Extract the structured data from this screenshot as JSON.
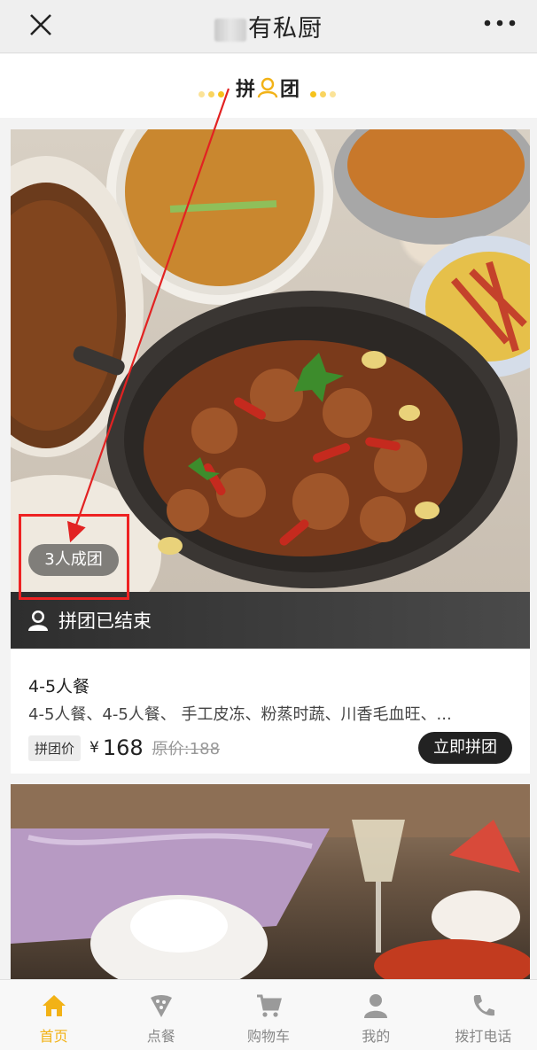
{
  "topbar": {
    "title": "有私厨"
  },
  "groupbar": {
    "label_left": "拼",
    "label_right": "团"
  },
  "card1": {
    "badge": "3人成团",
    "ended_text": "拼团已结束",
    "name": "4-5人餐",
    "desc": "4-5人餐、4-5人餐、 手工皮冻、粉蒸时蔬、川香毛血旺、...",
    "price_tag": "拼团价",
    "currency": "¥",
    "price": "168",
    "original_price": "原价:188",
    "buy_label": "立即拼团"
  },
  "tabs": [
    {
      "label": "首页",
      "icon": "home-icon",
      "active": true
    },
    {
      "label": "点餐",
      "icon": "pizza-icon",
      "active": false
    },
    {
      "label": "购物车",
      "icon": "cart-icon",
      "active": false
    },
    {
      "label": "我的",
      "icon": "person-icon",
      "active": false
    },
    {
      "label": "拨打电话",
      "icon": "phone-icon",
      "active": false
    }
  ],
  "colors": {
    "accent": "#f2b216",
    "annotation": "#e22222"
  }
}
